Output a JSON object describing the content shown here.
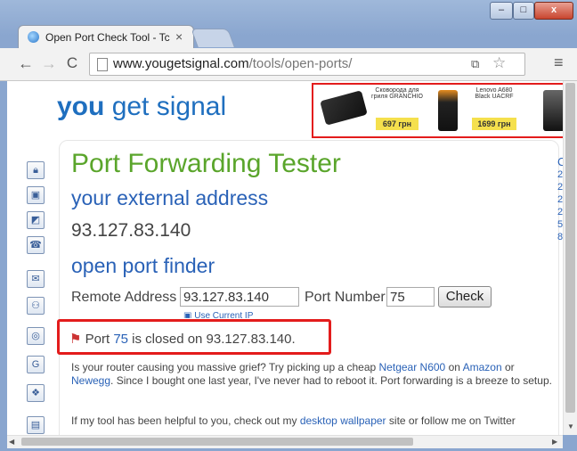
{
  "browser": {
    "tab_title": "Open Port Check Tool - Tc",
    "tab_close": "×",
    "url_host": "www.yougetsignal.com",
    "url_path": "/tools/open-ports/",
    "window_buttons": {
      "minimize": "–",
      "maximize": "□",
      "close": "x"
    }
  },
  "site": {
    "logo_you": "you",
    "logo_rest": "get signal"
  },
  "ad": {
    "item1_title": "Сковорода для гриля GRANCHIO",
    "item1_price": "697 грн",
    "item2_title": "Lenovo A680 Black UACRF",
    "item2_price": "1699 грн"
  },
  "page": {
    "title": "Port Forwarding Tester",
    "external_heading": "your external address",
    "external_ip": "93.127.83.140",
    "finder_heading": "open port finder",
    "remote_label": "Remote Address",
    "remote_value": "93.127.83.140",
    "port_label": "Port Number",
    "port_value": "75",
    "check_button": "Check",
    "use_current_ip": "Use Current IP",
    "result_prefix": "Port",
    "result_port": "75",
    "result_suffix": "is closed on 93.127.83.140.",
    "para1_a": "Is your router causing you massive grief? Try picking up a cheap",
    "para1_link1": "Netgear N600",
    "para1_b": "on",
    "para1_link2": "Amazon",
    "para1_c": "or",
    "para1_link3": "Newegg",
    "para1_d": ". Since I bought one last year, I've never had to reboot it. Port forwarding is a breeze to setup.",
    "para2_a": "If my tool has been helpful to you, check out my",
    "para2_link": "desktop wallpaper",
    "para2_b": "site or follow me on Twitter",
    "right_sidebar_chars": [
      "C",
      "2",
      "2",
      "2",
      "2",
      "5",
      "8",
      "",
      "",
      "",
      "",
      "",
      "",
      "",
      "",
      ""
    ]
  },
  "colors": {
    "title_green": "#5aa52b",
    "heading_blue": "#2a62b7",
    "highlight_red": "#e31c1c",
    "logo_blue": "#1f6fbf"
  }
}
